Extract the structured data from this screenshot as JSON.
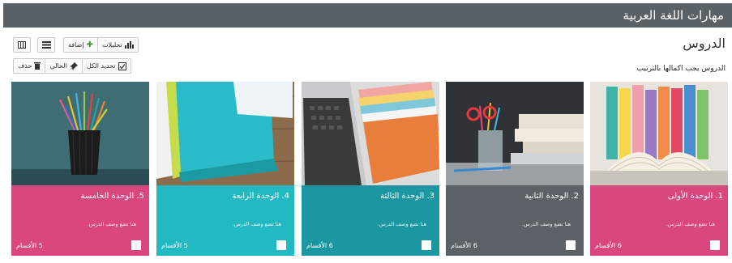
{
  "app": {
    "title": "مهارات اللغة العربية"
  },
  "section": {
    "title": "الدروس",
    "subtitle": "الدروس يجب اكمالها بالترتيب"
  },
  "toolbar": {
    "reports_label": "تحليلات",
    "add_label": "إضافة",
    "select_all_label": "تحديد الكل",
    "current_label": "الحالي",
    "delete_label": "حذف"
  },
  "icons": {
    "grid_view": "grid-view-icon",
    "list_view": "list-view-icon",
    "reports": "bar-chart-icon",
    "add": "plus-icon",
    "select_all": "checkbox-icon",
    "current": "pin-icon",
    "delete": "trash-icon"
  },
  "cards": [
    {
      "title": "1. الوحدة الأولى",
      "desc": "هنا تضع وصف الدرس.",
      "count": "6 الأقسام",
      "color": "#d9477e"
    },
    {
      "title": "2. الوحدة الثانية",
      "desc": "هنا تضع وصف الدرس.",
      "count": "6 الأقسام",
      "color": "#5b6166"
    },
    {
      "title": "3. الوحدة الثالثة",
      "desc": "هنا تضع وصف الدرس.",
      "count": "6 الأقسام",
      "color": "#1c96a1"
    },
    {
      "title": "4. الوحدة الرابعة",
      "desc": "هنا تضع وصف الدرس.",
      "count": "5 الأقسام",
      "color": "#22b9c3"
    },
    {
      "title": "5. الوحدة الخامسة",
      "desc": "هنا تضع وصف الدرس.",
      "count": "5 الأقسام",
      "color": "#d9477e"
    }
  ],
  "colors": {
    "header": "#5a6166",
    "pink": "#d9477e",
    "gray": "#5b6166",
    "teal": "#1c96a1",
    "cyan": "#22b9c3"
  }
}
